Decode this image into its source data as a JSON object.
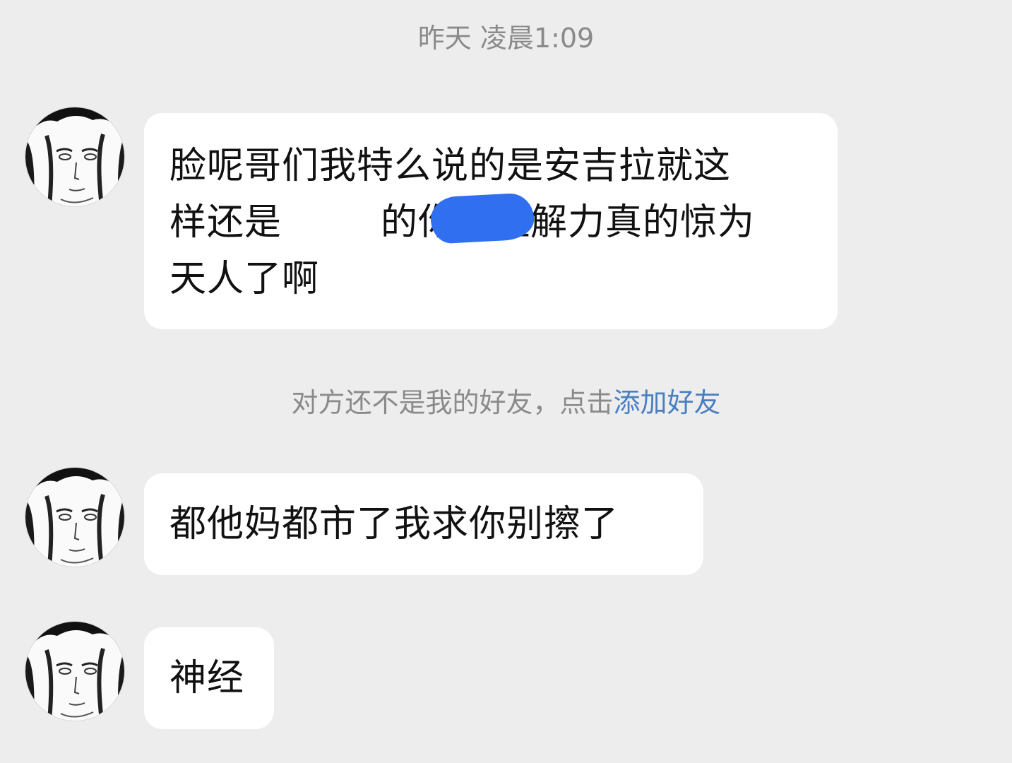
{
  "chat": {
    "timestamp": "昨天 凌晨1:09",
    "messages": [
      {
        "lines": [
          "脸呢哥们我特么说的是安吉拉就这",
          "样还是",
          "的你的理解力真的惊为",
          "天人了啊"
        ]
      },
      {
        "lines": [
          "都他妈都市了我求你别擦了"
        ]
      },
      {
        "lines": [
          "神经"
        ]
      }
    ],
    "notice": {
      "prefix": "对方还不是我的好友，点击",
      "link": "添加好友"
    }
  },
  "colors": {
    "background": "#ededed",
    "bubble": "#ffffff",
    "link": "#4a7fc1",
    "redaction": "#2f6ff0"
  }
}
